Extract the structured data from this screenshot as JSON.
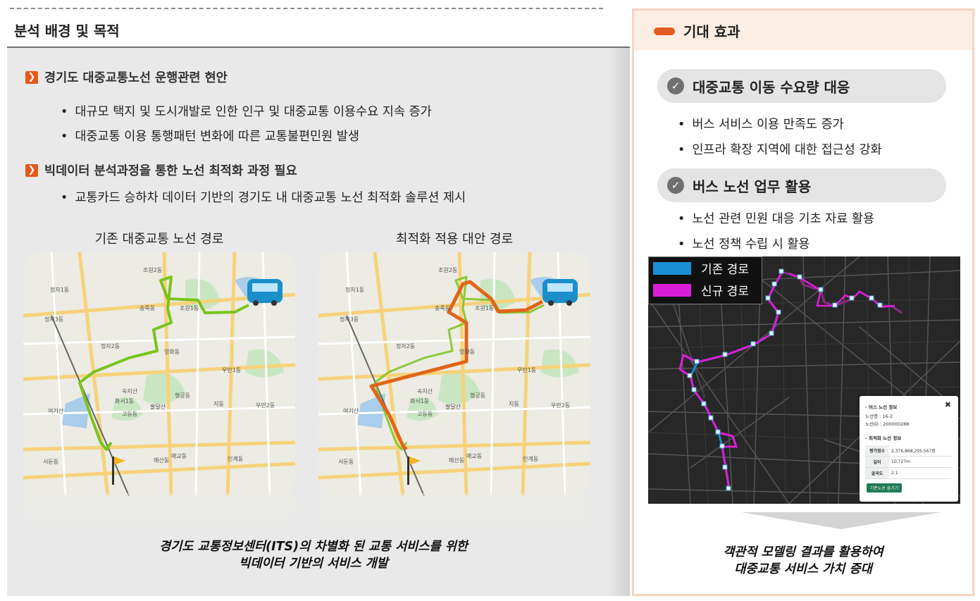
{
  "left": {
    "title": "분석 배경 및 목적",
    "sections": [
      {
        "heading": "경기도 대중교통노선 운행관련 현안",
        "bullets": [
          "대규모 택지 및 도시개발로 인한 인구 및 대중교통 이용수요 지속 증가",
          "대중교통 이용 통행패턴 변화에 따른 교통불편민원 발생"
        ]
      },
      {
        "heading": "빅데이터 분석과정을 통한 노선 최적화 과정 필요",
        "bullets": [
          "교통카드 승하차 데이터 기반의 경기도 내 대중교통 노선 최적화 솔루션 제시"
        ]
      }
    ],
    "map_captions": [
      "기존 대중교통 노선 경로",
      "최적화 적용 대안 경로"
    ],
    "map_labels": [
      "조원2동",
      "조원1동",
      "송죽동",
      "정자1동",
      "정자2동",
      "정자3동",
      "영화동",
      "우만1동",
      "우만2동",
      "화서1동",
      "고등동",
      "지동",
      "매산동",
      "매교동",
      "서둔동",
      "인계동",
      "행궁동",
      "팔달산",
      "숙지산",
      "여기산"
    ],
    "bottom_text": [
      "경기도 교통정보센터(ITS)의 차별화 된 교통 서비스를 위한",
      "빅데이터 기반의 서비스 개발"
    ]
  },
  "right": {
    "title": "기대 효과",
    "effects": [
      {
        "label": "대중교통 이동 수요량 대응",
        "bullets": [
          "버스 서비스 이용 만족도 증가",
          "인프라 확장 지역에 대한 접근성 강화"
        ]
      },
      {
        "label": "버스 노선 업무 활용",
        "bullets": [
          "노선 관련 민원 대응 기초 자료 활용",
          "노선 정책 수립 시 활용"
        ]
      }
    ],
    "legend": [
      {
        "label": "기존 경로",
        "color": "#1a8fd8"
      },
      {
        "label": "신규 경로",
        "color": "#d81fd8"
      }
    ],
    "popup": {
      "title": "- 버스 노선 정보",
      "close": "✖",
      "route_name": "노선명 : 16-2",
      "route_id": "노선ID : 200000288",
      "opt_title": "- 최적화 노선 정보",
      "rows": [
        {
          "key": "평가점수",
          "value": "2,376,868,295,567점"
        },
        {
          "key": "길이",
          "value": "10,727m"
        },
        {
          "key": "굴곡도",
          "value": "2.1"
        }
      ],
      "button": "기존노선 숨기기"
    },
    "bottom_text": [
      "객관적 모델링 결과를 활용하여",
      "대중교통 서비스 가치 증대"
    ]
  },
  "colors": {
    "accent": "#e4581c",
    "existing_route": "#7ac41c",
    "new_route": "#e0661a"
  }
}
